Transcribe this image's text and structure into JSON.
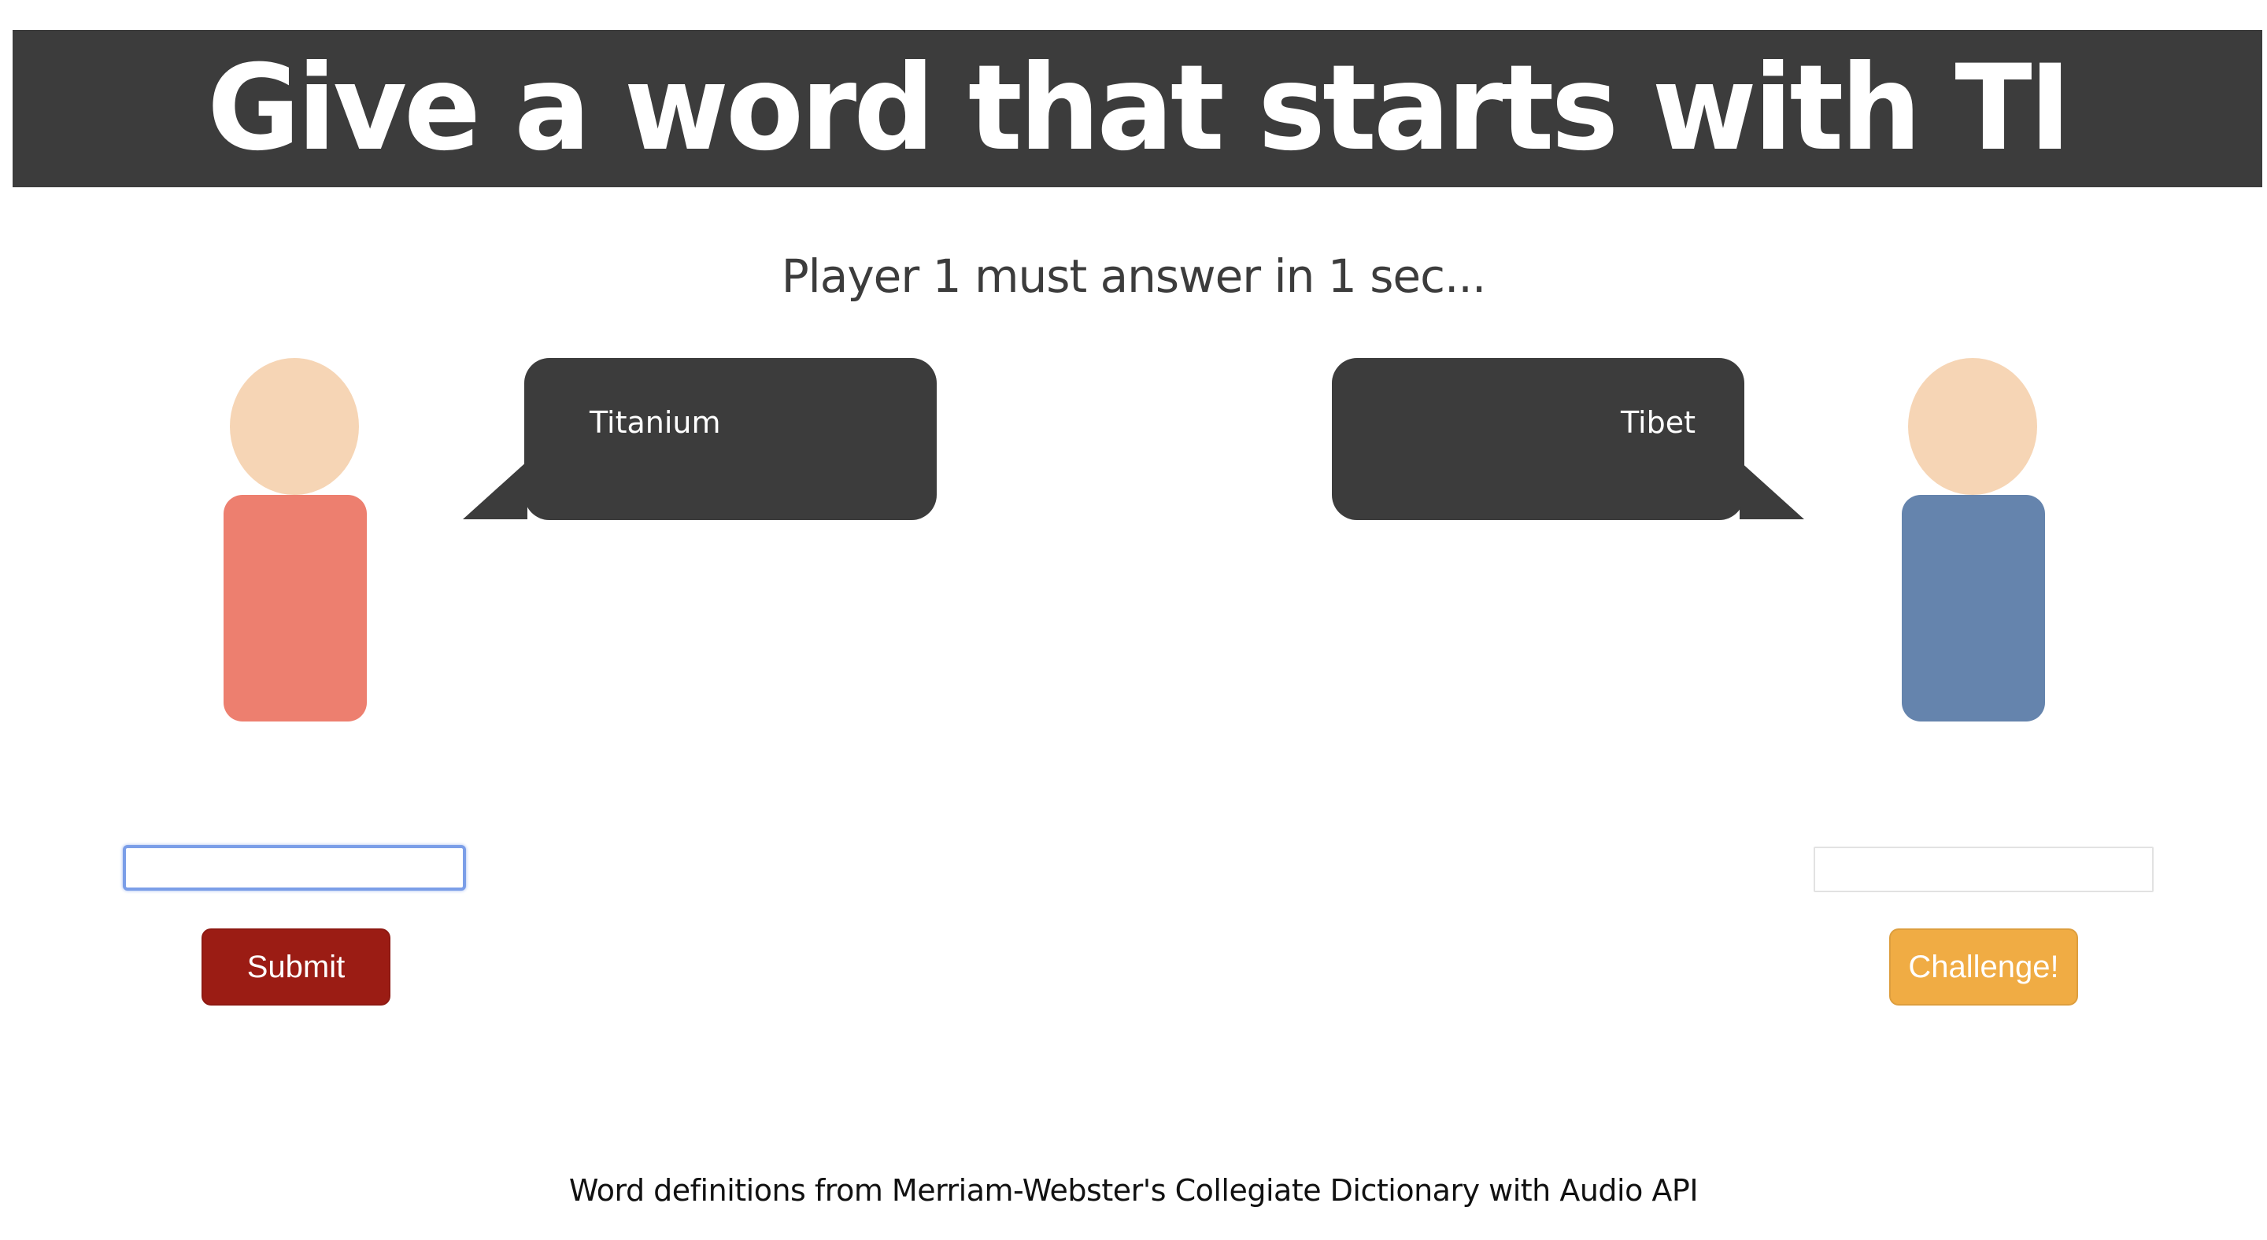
{
  "header": {
    "title": "Give a word that starts with TI"
  },
  "status": {
    "text": "Player 1 must answer in 1 sec..."
  },
  "player1": {
    "bubble_text": "Titanium",
    "input_value": "",
    "button_label": "Submit",
    "shirt_color": "#ed7f6f",
    "button_color": "#9b1c14"
  },
  "player2": {
    "bubble_text": "Tibet",
    "input_value": "",
    "button_label": "Challenge!",
    "shirt_color": "#6584ad",
    "button_color": "#f0ac44"
  },
  "colors": {
    "header_bg": "#3c3c3c",
    "bubble_bg": "#3c3c3c",
    "skin": "#f6d5b5"
  },
  "footer": {
    "credit": "Word definitions from Merriam-Webster's Collegiate Dictionary with Audio API"
  }
}
